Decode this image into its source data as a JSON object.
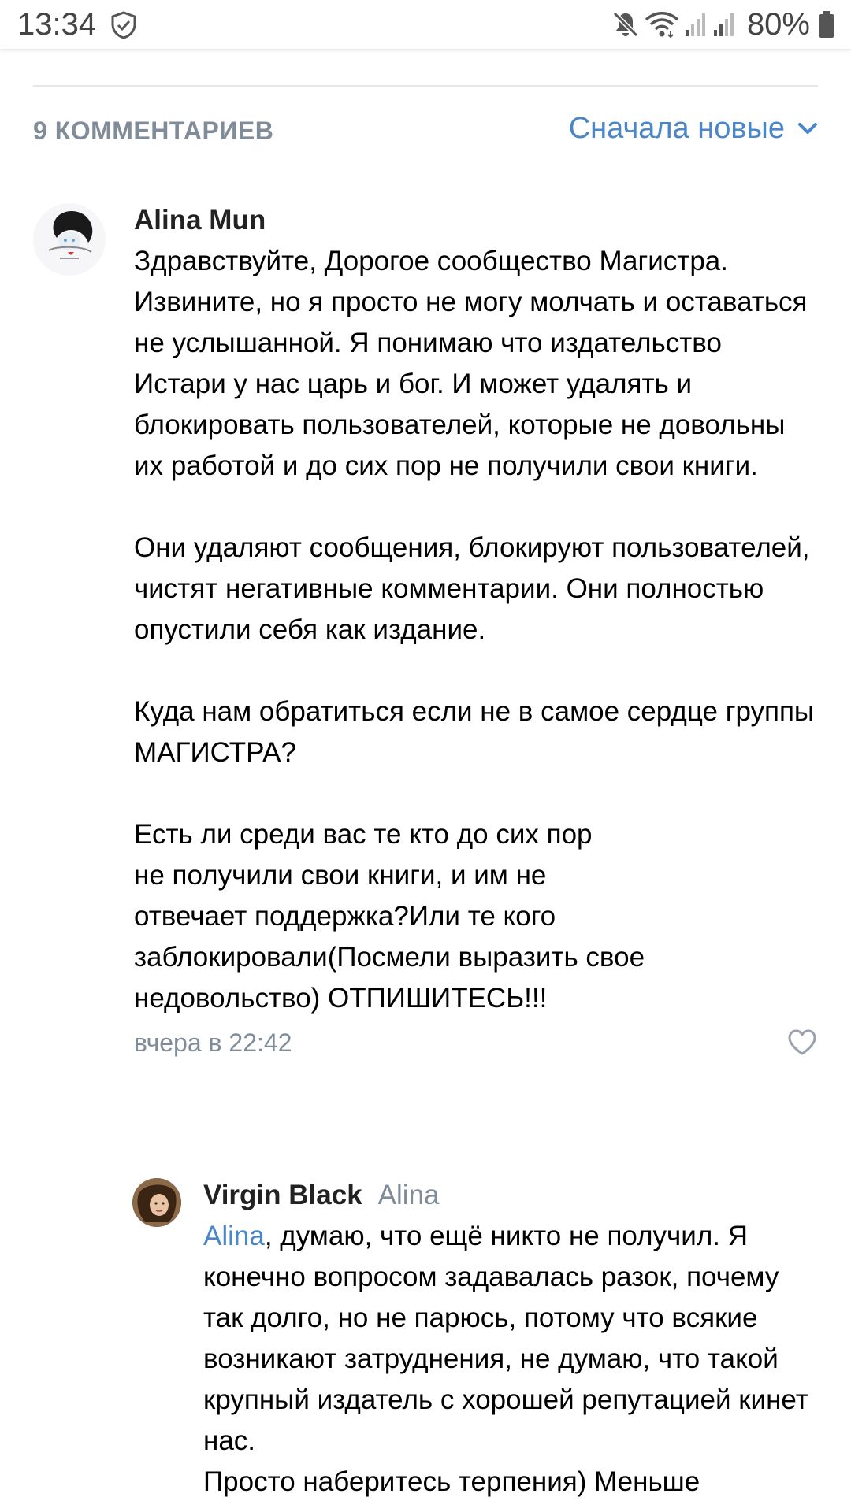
{
  "status_bar": {
    "time": "13:34",
    "battery": "80%",
    "icons": [
      "shield-icon",
      "mute-icon",
      "wifi-icon",
      "signal-icon",
      "signal-icon",
      "battery-icon"
    ]
  },
  "comments_header": {
    "count_label": "9 КОММЕНТАРИЕВ",
    "sort_label": "Сначала новые"
  },
  "comments": [
    {
      "author": "Alina Mun",
      "text": "Здравствуйте, Дорогое сообщество Магистра. Извините, но я просто не могу молчать и оставаться не услышанной. Я понимаю что издательство Истари у нас царь и бог. И может удалять и блокировать пользователей, которые не довольны их работой и до сих пор не получили свои книги.\n\nОни удаляют сообщения, блокируют пользователей, чистят негативные комментарии. Они полностью опустили себя как издание.\n\nКуда нам обратиться если не в самое сердце группы МАГИСТРА?\n\nЕсть ли среди вас те кто до сих пор\nне получили свои книги, и им не\nотвечает поддержка?Или те кого\nзаблокировали(Посмели выразить свое недовольство) ОТПИШИТЕСЬ!!!",
      "timestamp": "вчера в 22:42"
    },
    {
      "author": "Virgin Black",
      "reply_to": "Alina",
      "mention": "Alina",
      "text": ", думаю, что ещё никто не получил. Я конечно вопросом задавалась разок, почему так долго, но не парюсь, потому что всякие возникают затруднения, не думаю, что такой крупный издатель с хорошей репутацией кинет нас.\nПросто наберитесь терпения) Меньше"
    }
  ],
  "colors": {
    "accent": "#4a86c8",
    "secondary_text": "#818c99",
    "divider": "#e7e8ec"
  }
}
